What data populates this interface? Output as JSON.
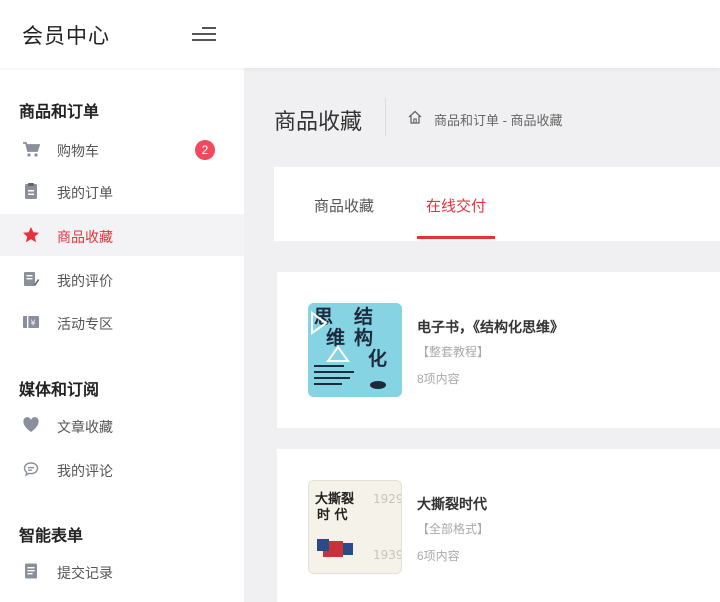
{
  "header": {
    "brand": "会员中心",
    "menu_icon": "menu-fold-icon"
  },
  "sidebar": {
    "groups": [
      {
        "title": "商品和订单",
        "items": [
          {
            "label": "购物车",
            "icon": "cart-icon",
            "badge": "2"
          },
          {
            "label": "我的订单",
            "icon": "clipboard-icon"
          },
          {
            "label": "商品收藏",
            "icon": "star-icon",
            "active": true
          },
          {
            "label": "我的评价",
            "icon": "edit-note-icon"
          },
          {
            "label": "活动专区",
            "icon": "coupon-icon"
          }
        ]
      },
      {
        "title": "媒体和订阅",
        "items": [
          {
            "label": "文章收藏",
            "icon": "heart-icon"
          },
          {
            "label": "我的评论",
            "icon": "comment-icon"
          }
        ]
      },
      {
        "title": "智能表单",
        "items": [
          {
            "label": "提交记录",
            "icon": "document-icon"
          }
        ]
      }
    ]
  },
  "main": {
    "page_title": "商品收藏",
    "breadcrumb": "商品和订单 - 商品收藏",
    "tabs": [
      {
        "label": "商品收藏",
        "active": false
      },
      {
        "label": "在线交付",
        "active": true
      }
    ],
    "items": [
      {
        "title": "电子书，《结构化思维》",
        "tag": "【整套教程】",
        "count": "8项内容",
        "cover_text": "结构化思维"
      },
      {
        "title": "大撕裂时代",
        "tag": "【全部格式】",
        "count": "6项内容",
        "cover_text": "大撕裂时代 1929 1939"
      }
    ]
  },
  "colors": {
    "accent": "#e8313d",
    "badge": "#f04a5f",
    "icon_gray": "#8a8f9c"
  }
}
